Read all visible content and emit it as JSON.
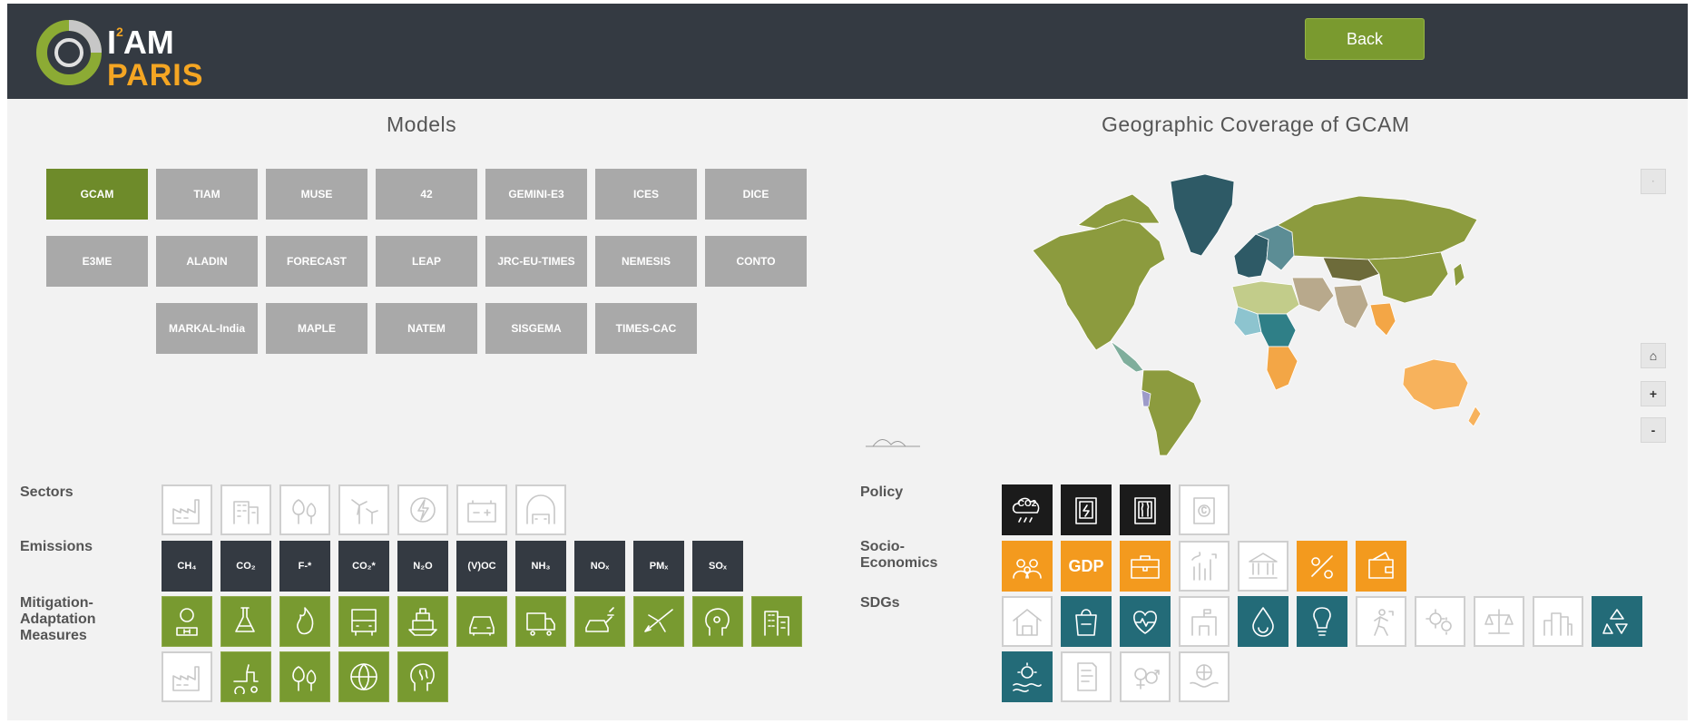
{
  "header": {
    "logo_top": "I",
    "logo_sup": "2",
    "logo_am": "AM",
    "logo_bottom": "PARIS",
    "back_label": "Back"
  },
  "models": {
    "title": "Models",
    "active": "GCAM",
    "rows": [
      [
        "GCAM",
        "TIAM",
        "MUSE",
        "42",
        "GEMINI-E3",
        "ICES",
        "DICE"
      ],
      [
        "E3ME",
        "ALADIN",
        "FORECAST",
        "LEAP",
        "JRC-EU-TIMES",
        "NEMESIS",
        "CONTO"
      ],
      [
        "MARKAL-India",
        "MAPLE",
        "NATEM",
        "SISGEMA",
        "TIMES-CAC"
      ]
    ]
  },
  "geo": {
    "title": "Geographic Coverage of GCAM",
    "controls": {
      "home": "⌂",
      "zoom_in": "+",
      "zoom_out": "-"
    }
  },
  "sectors": {
    "label": "Sectors",
    "icons": [
      "industry-icon",
      "buildings-icon",
      "forestry-icon",
      "wind-energy-icon",
      "energy-icon",
      "battery-icon",
      "transport-icon"
    ]
  },
  "emissions": {
    "label": "Emissions",
    "items": [
      "CH₄",
      "CO₂",
      "F-*",
      "CO₂*",
      "N₂O",
      "(V)OC",
      "NH₃",
      "NOₓ",
      "PMₓ",
      "SOₓ"
    ]
  },
  "mitigation": {
    "label_line1": "Mitigation-",
    "label_line2": "Adaptation",
    "label_line3": "Measures",
    "icons_row1": [
      "hydrogen-icon",
      "chemistry-icon",
      "bioenergy-icon",
      "bus-icon",
      "ship-icon",
      "car-icon",
      "truck-icon",
      "electric-car-icon",
      "airplane-icon",
      "behaviour-icon",
      "efficient-buildings-icon"
    ],
    "icons_row2": [
      "factory-icon",
      "tractor-icon",
      "reforestation-icon",
      "globe-icon",
      "mind-icon"
    ]
  },
  "policy": {
    "label": "Policy",
    "co2_text": "CO2",
    "icons": [
      "carbon-tax-icon",
      "energy-policy-icon",
      "environment-policy-icon",
      "finance-policy-icon"
    ]
  },
  "socio": {
    "label_line1": "Socio-",
    "label_line2": "Economics",
    "gdp_text": "GDP",
    "icons": [
      "population-icon",
      "gdp-icon",
      "employment-icon",
      "investment-icon",
      "institutions-icon",
      "interest-rate-icon",
      "wallet-icon"
    ]
  },
  "sdgs": {
    "label": "SDGs",
    "row1": [
      "no-poverty-icon",
      "zero-hunger-icon",
      "good-health-icon",
      "quality-education-icon",
      "clean-water-icon",
      "clean-energy-icon",
      "decent-work-icon",
      "innovation-icon",
      "reduced-inequalities-icon",
      "sustainable-cities-icon",
      "responsible-consumption-icon"
    ],
    "row2": [
      "climate-action-icon",
      "life-below-water-icon",
      "gender-equality-icon",
      "peace-justice-icon"
    ]
  },
  "colors": {
    "header": "#343a42",
    "accent_green": "#6e8b2a",
    "button_green": "#7a9a2f",
    "inactive": "#a9a9a9",
    "orange": "#f39a1e",
    "teal": "#236b78",
    "dark": "#343a42"
  }
}
